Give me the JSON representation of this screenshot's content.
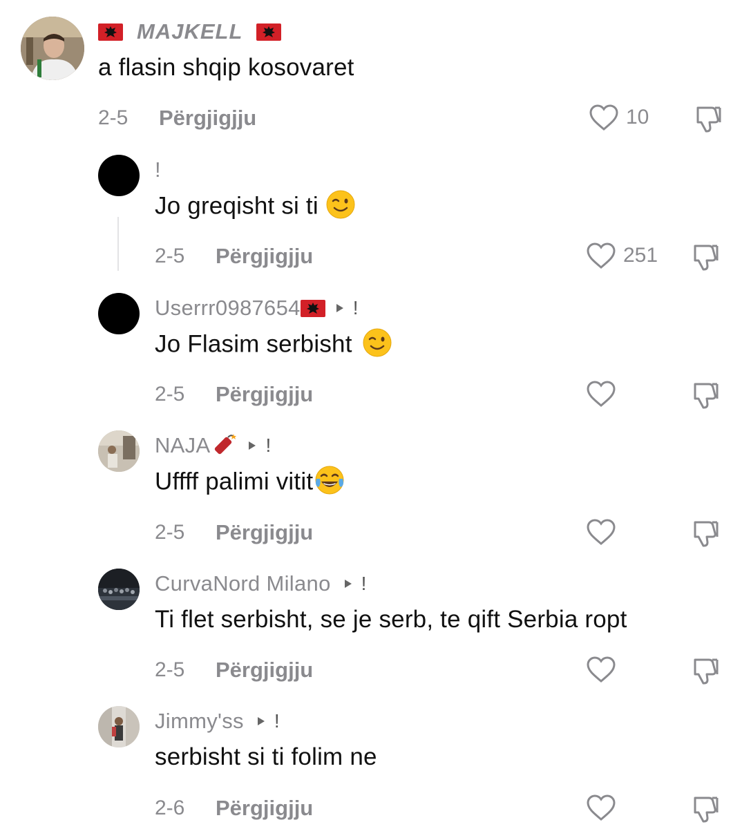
{
  "comments": [
    {
      "username": "MAJKELL",
      "text": "a flasin shqip kosovaret",
      "date": "2-5",
      "reply_label": "Përgjigjju",
      "likes": "10"
    },
    {
      "username": "!",
      "text": "Jo greqisht si ti",
      "date": "2-5",
      "reply_label": "Përgjigjju",
      "likes": "251",
      "emoji": "wink-emoji"
    },
    {
      "username": "Userrr0987654",
      "text": "Jo Flasim serbisht",
      "date": "2-5",
      "reply_label": "Përgjigjju",
      "likes": "",
      "emoji": "wink-emoji",
      "suffix": "!"
    },
    {
      "username": "NAJA",
      "text": "Uffff palimi vitit",
      "date": "2-5",
      "reply_label": "Përgjigjju",
      "likes": "",
      "emoji": "tears-of-joy-emoji",
      "suffix": "!"
    },
    {
      "username": "CurvaNord Milano",
      "text": "Ti flet serbisht, se je serb, te qift Serbia ropt",
      "date": "2-5",
      "reply_label": "Përgjigjju",
      "likes": "",
      "suffix": "!"
    },
    {
      "username": "Jimmy'ss",
      "text": "serbisht si ti folim ne",
      "date": "2-6",
      "reply_label": "Përgjigjju",
      "likes": "",
      "suffix": "!"
    }
  ],
  "colors": {
    "muted": "#8a8a8e",
    "flag": "#d22027",
    "text": "#111111"
  }
}
